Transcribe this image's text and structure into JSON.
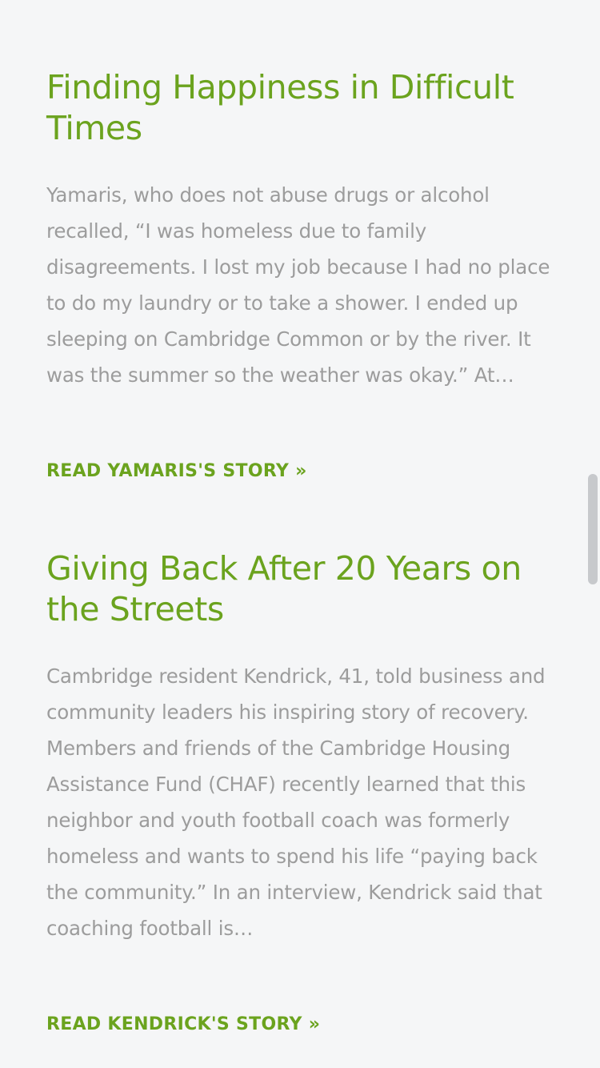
{
  "stories": [
    {
      "title": "Finding Happiness in Difficult Times",
      "excerpt": "Yamaris, who does not abuse drugs or alcohol recalled, “I was homeless due to family disagreements. I lost my job because I had no place to do my laundry or to take a shower. I ended up sleeping on Cambridge Common or by the river. It was the summer so the weather was okay.” At…",
      "link_label": "READ YAMARIS'S STORY »"
    },
    {
      "title": "Giving Back After 20 Years on the Streets",
      "excerpt": "Cambridge resident Kendrick, 41, told business and community leaders his inspiring story of recovery. Members and friends of the Cambridge Housing Assistance Fund (CHAF) recently learned that this neighbor and youth football coach was formerly homeless and wants to spend his life “paying back the community.” In an interview, Kendrick said that coaching football is…",
      "link_label": "READ KENDRICK'S STORY »"
    }
  ],
  "colors": {
    "accent": "#6ba31e",
    "body_text": "#9c9c9c",
    "background": "#f5f6f7",
    "scrollbar": "#c7c9cc"
  }
}
